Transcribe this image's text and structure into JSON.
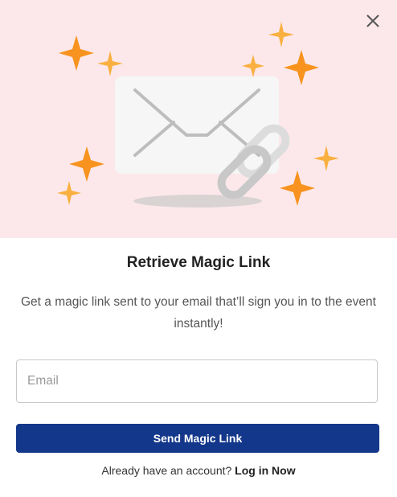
{
  "modal": {
    "title": "Retrieve Magic Link",
    "subtitle": "Get a magic link sent to your email that’ll sign you in to the event instantly!",
    "email_placeholder": "Email",
    "email_value": "",
    "send_button_label": "Send Magic Link",
    "login_prompt": "Already have an account?",
    "login_link_label": "Log in Now"
  },
  "illustration": {
    "icons": [
      "envelope-icon",
      "chain-link-icon",
      "sparkle-icon"
    ]
  },
  "icons": {
    "close": "close-icon"
  },
  "colors": {
    "hero_background": "#fce8ea",
    "sparkle_dark": "#f7931e",
    "sparkle_light": "#f9b040",
    "button_primary": "#13378a",
    "envelope": "#f6f6f6",
    "chain_link": "#c8c8c8"
  }
}
